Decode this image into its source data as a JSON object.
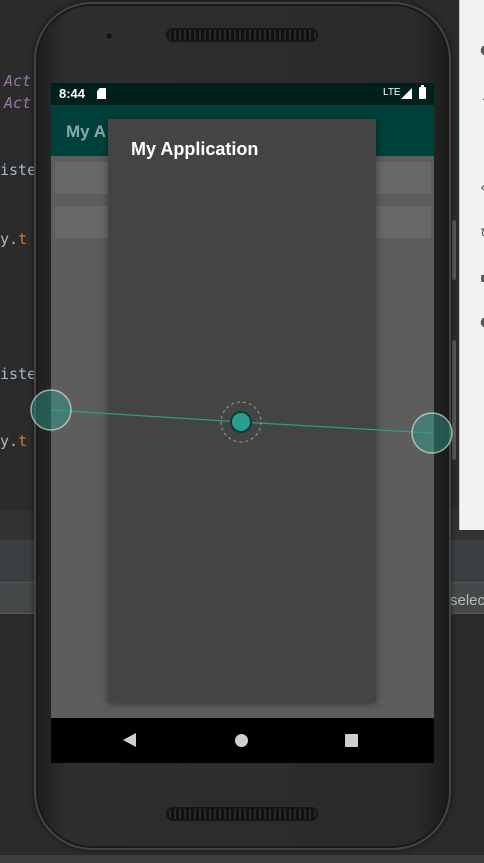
{
  "ide": {
    "lines": [
      {
        "text": "Act",
        "style": "italic"
      },
      {
        "text": "Act",
        "style": "italic"
      },
      {
        "text": "iste",
        "style": "plain"
      },
      {
        "text": "y.",
        "accent": "t"
      },
      {
        "text": "iste",
        "style": "plain"
      },
      {
        "text": "y.",
        "accent": "t"
      }
    ],
    "right_panel_text": "selec"
  },
  "status_bar": {
    "time": "8:44",
    "network": "LTE",
    "sd_icon": "sd-card-icon",
    "signal_icon": "cell-signal-icon",
    "battery_icon": "battery-icon"
  },
  "app_bar": {
    "title": "My A"
  },
  "dialog": {
    "title": "My Application"
  },
  "nav_bar": {
    "back_icon": "back-triangle-icon",
    "home_icon": "home-circle-icon",
    "recents_icon": "recents-square-icon"
  },
  "colors": {
    "status_bar": "#00201c",
    "app_bar": "#00403a",
    "touch_accent": "#2a9d8f",
    "dialog_bg": "#444444"
  }
}
